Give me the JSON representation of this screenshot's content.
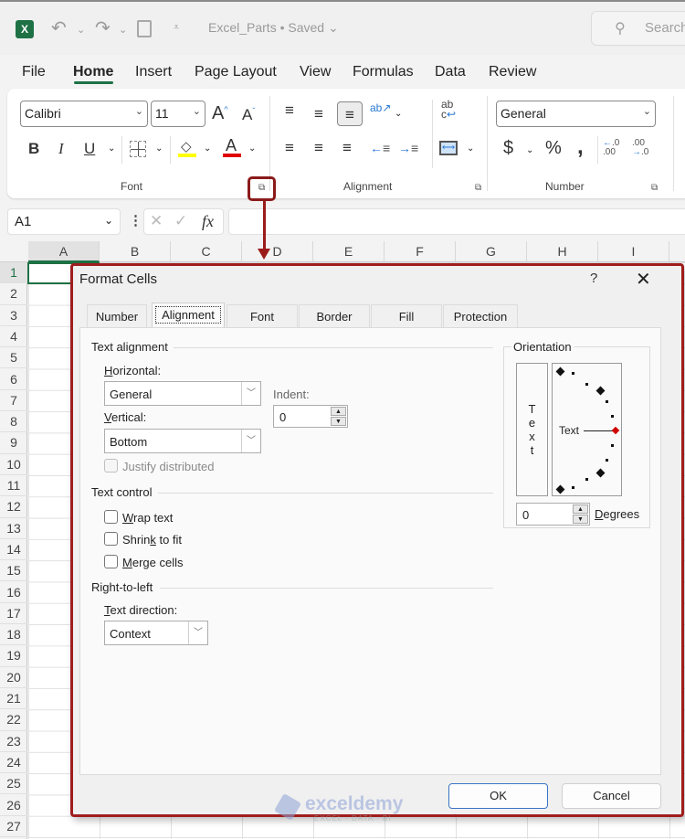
{
  "titlebar": {
    "app_icon": "excel-logo-icon",
    "undo_icon": "undo-icon",
    "redo_icon": "redo-icon",
    "autosave_icon": "autosave-icon",
    "customize_icon": "customize-qat-icon",
    "doc_title": "Excel_Parts • Saved ⌄",
    "search_placeholder": "Search"
  },
  "menu": {
    "tabs": [
      "File",
      "Home",
      "Insert",
      "Page Layout",
      "View",
      "Formulas",
      "Data",
      "Review"
    ],
    "active": "Home"
  },
  "ribbon": {
    "font": {
      "font_name": "Calibri",
      "font_size": "11",
      "grow": "A",
      "shrink": "A",
      "bold": "B",
      "italic": "I",
      "underline": "U",
      "fill_color": "#ffff00",
      "font_color": "#e00000",
      "font_color_letter": "A",
      "label": "Font"
    },
    "alignment": {
      "label": "Alignment"
    },
    "number": {
      "format": "General",
      "currency": "$",
      "percent": "%",
      "comma": "❟",
      "inc_decimal": "←.0 .00",
      "dec_decimal": ".00 →.0",
      "label": "Number"
    }
  },
  "formula_bar": {
    "name_box": "A1",
    "cancel": "✕",
    "enter": "✓",
    "fx": "fx",
    "value": ""
  },
  "grid": {
    "columns": [
      "A",
      "B",
      "C",
      "D",
      "E",
      "F",
      "G",
      "H",
      "I"
    ],
    "rows": [
      "1",
      "2",
      "3",
      "4",
      "5",
      "6",
      "7",
      "8",
      "9",
      "10",
      "11",
      "12",
      "13",
      "14",
      "15",
      "16",
      "17",
      "18",
      "19",
      "20",
      "21",
      "22",
      "23",
      "24",
      "25",
      "26",
      "27"
    ],
    "selected_cell": "A1"
  },
  "dialog": {
    "title": "Format Cells",
    "help": "?",
    "close": "✕",
    "tabs": [
      "Number",
      "Alignment",
      "Font",
      "Border",
      "Fill",
      "Protection"
    ],
    "active_tab": "Alignment",
    "text_alignment": {
      "heading": "Text alignment",
      "horizontal_label_u": "H",
      "horizontal_label_rest": "orizontal:",
      "horizontal_value": "General",
      "vertical_label_u": "V",
      "vertical_label_rest": "ertical:",
      "vertical_value": "Bottom",
      "indent_label": "Indent:",
      "indent_value": "0",
      "justify_distributed": "Justify distributed",
      "justify_distributed_checked": false,
      "justify_distributed_enabled": false
    },
    "text_control": {
      "heading": "Text control",
      "options": [
        {
          "pre": "",
          "u": "W",
          "post": "rap text",
          "checked": false
        },
        {
          "pre": "Shrin",
          "u": "k",
          "post": " to fit",
          "checked": false
        },
        {
          "pre": "",
          "u": "M",
          "post": "erge cells",
          "checked": false
        }
      ]
    },
    "right_to_left": {
      "heading": "Right-to-left",
      "direction_label_u": "T",
      "direction_label_rest": "ext direction:",
      "direction_value": "Context"
    },
    "orientation": {
      "heading": "Orientation",
      "vertical_text": [
        "T",
        "e",
        "x",
        "t"
      ],
      "dial_text": "Text",
      "degrees_value": "0",
      "degrees_label_u": "D",
      "degrees_label_rest": "egrees",
      "indicator_color": "#d00000"
    },
    "ok": "OK",
    "cancel": "Cancel"
  },
  "annotation": {
    "color": "#9b1b1b"
  },
  "watermark": {
    "brand": "exceldemy",
    "tagline": "EXCEL · DATA · BI"
  }
}
